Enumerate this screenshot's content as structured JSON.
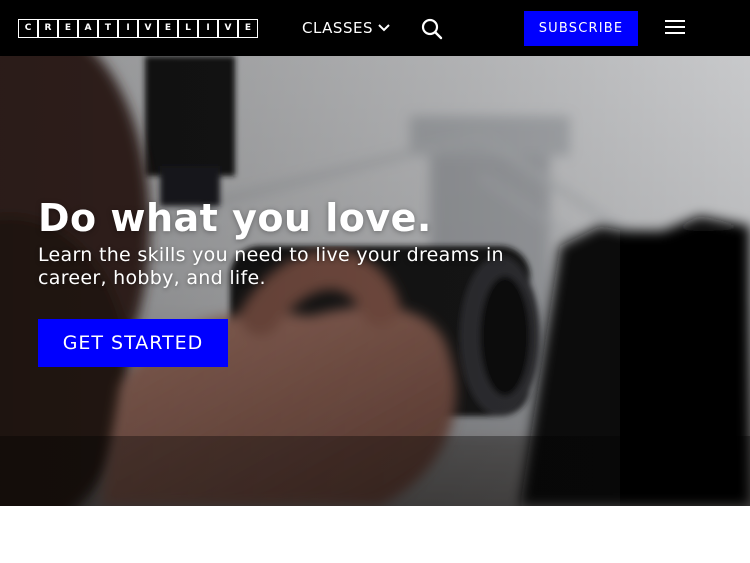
{
  "header": {
    "logo_letters": [
      "C",
      "R",
      "E",
      "A",
      "T",
      "I",
      "V",
      "E",
      "L",
      "I",
      "V",
      "E"
    ],
    "classes_label": "CLASSES",
    "subscribe_label": "SUBSCRIBE",
    "icons": {
      "classes_chevron": "chevron-down-icon",
      "search": "search-icon",
      "menu": "hamburger-menu-icon"
    }
  },
  "hero": {
    "headline": "Do what you love.",
    "subline": "Learn the skills you need to live your dreams in career, hobby, and life.",
    "cta_label": "GET STARTED",
    "photo": "photographer-with-camera-near-bridge"
  },
  "colors": {
    "accent": "#0000ff",
    "header_bg": "#000000",
    "text": "#ffffff"
  }
}
